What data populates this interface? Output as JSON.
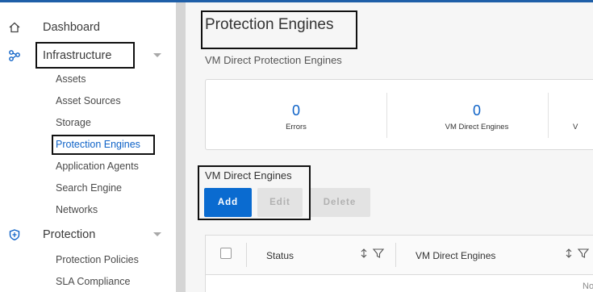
{
  "sidebar": {
    "dashboard": "Dashboard",
    "infrastructure": "Infrastructure",
    "infra_items": [
      "Assets",
      "Asset Sources",
      "Storage",
      "Protection Engines",
      "Application Agents",
      "Search Engine",
      "Networks"
    ],
    "protection": "Protection",
    "protection_items": [
      "Protection Policies",
      "SLA Compliance"
    ]
  },
  "main": {
    "title": "Protection Engines",
    "subtitle": "VM Direct Protection Engines",
    "metrics": [
      {
        "value": "0",
        "caption": "Errors"
      },
      {
        "value": "0",
        "caption": "VM Direct Engines"
      },
      {
        "value": "",
        "caption": "V"
      }
    ],
    "engines_title": "VM Direct Engines",
    "buttons": {
      "add": "Add",
      "edit": "Edit",
      "delete": "Delete"
    },
    "table": {
      "columns": [
        "Status",
        "VM Direct Engines"
      ],
      "empty": "No"
    }
  },
  "colors": {
    "accent": "#0a6bd0",
    "active_link": "#0e62c7",
    "disabled_button": "#e3e3e3"
  },
  "icons": [
    "home-icon",
    "infrastructure-icon",
    "shield-icon",
    "chevron-down-icon",
    "sort-icon",
    "filter-icon"
  ]
}
